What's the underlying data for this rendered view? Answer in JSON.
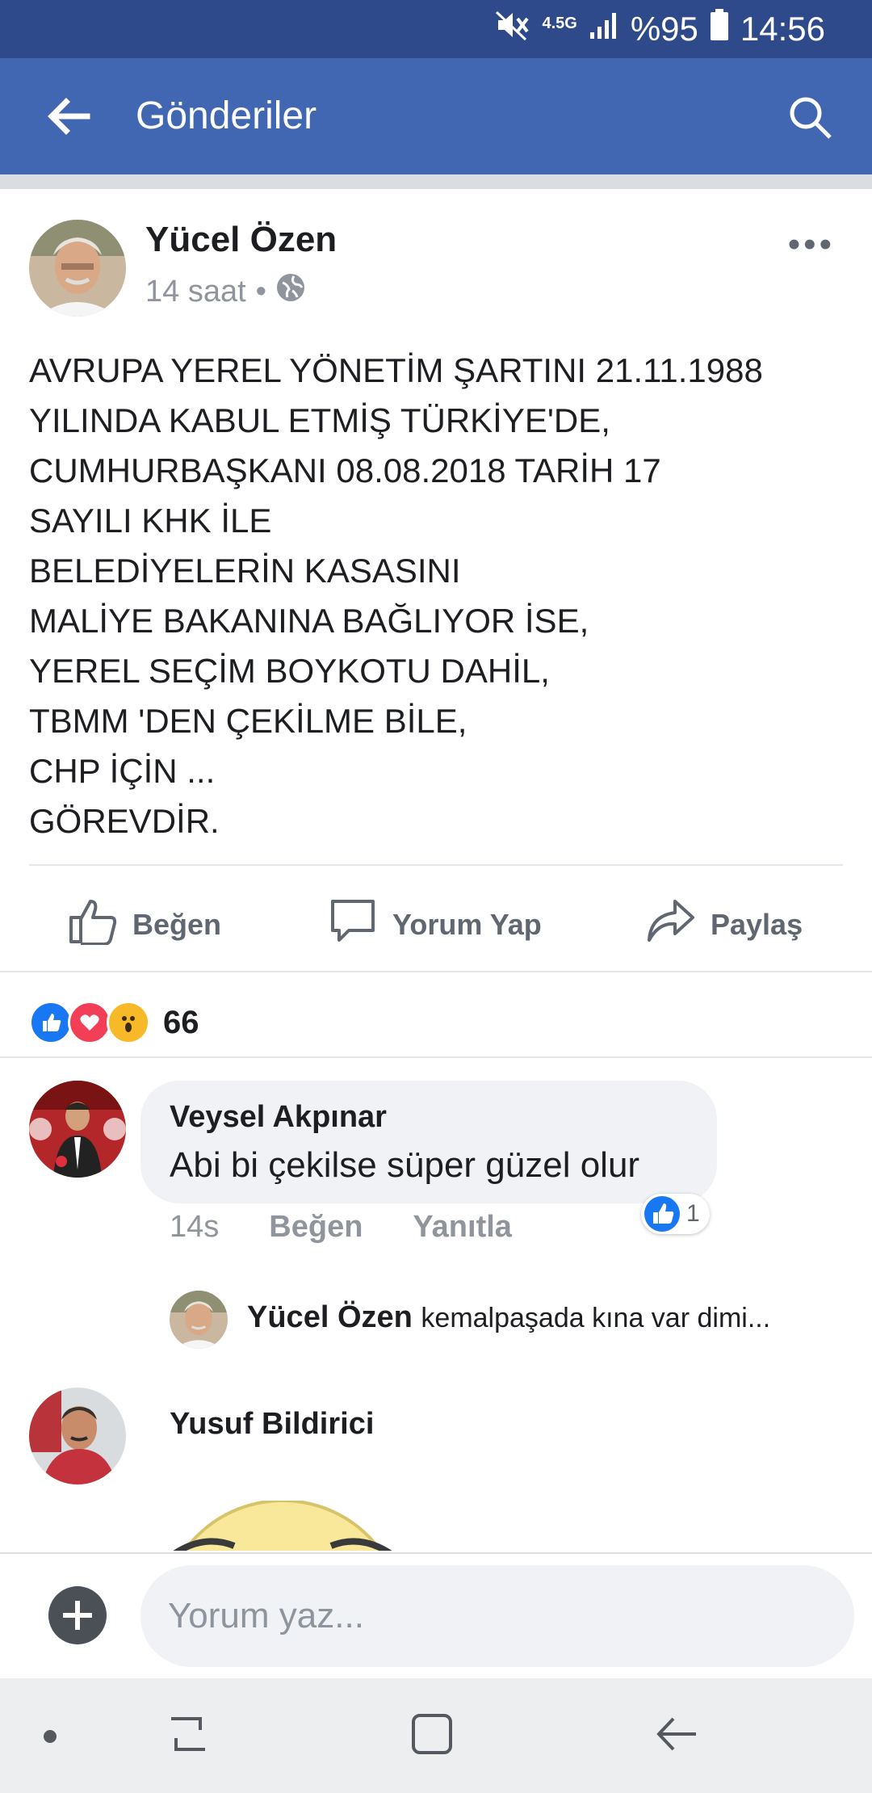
{
  "status_bar": {
    "network": "4.5G",
    "battery": "%95",
    "time": "14:56"
  },
  "app_bar": {
    "title": "Gönderiler",
    "back_icon": "arrow-left-icon",
    "search_icon": "search-icon"
  },
  "post": {
    "author": "Yücel Özen",
    "time": "14 saat",
    "separator": "•",
    "privacy_icon": "globe-icon",
    "lines": [
      "AVRUPA YEREL YÖNETİM ŞARTINI 21.11.1988",
      "YILINDA KABUL ETMİŞ TÜRKİYE'DE,",
      "CUMHURBAŞKANI 08.08.2018 TARİH 17",
      "SAYILI KHK İLE",
      "BELEDİYELERİN KASASINI",
      "MALİYE BAKANINA BAĞLIYOR İSE,",
      "YEREL SEÇİM BOYKOTU DAHİL,",
      "TBMM 'DEN ÇEKİLME BİLE,",
      "CHP İÇİN ...",
      "GÖREVDİR."
    ]
  },
  "actions": {
    "like": "Beğen",
    "comment": "Yorum Yap",
    "share": "Paylaş"
  },
  "reactions": {
    "count": "66",
    "types": [
      "like",
      "love",
      "wow"
    ]
  },
  "comments": [
    {
      "author": "Veysel Akpınar",
      "text": "Abi bi çekilse süper güzel olur",
      "time": "14s",
      "like_label": "Beğen",
      "reply_label": "Yanıtla",
      "like_count": "1",
      "reply": {
        "author": "Yücel Özen",
        "text": "kemalpaşada kına var dimi..."
      }
    },
    {
      "author": "Yusuf Bildirici"
    }
  ],
  "composer": {
    "placeholder": "Yorum yaz..."
  },
  "colors": {
    "status_bar": "#2f4a8a",
    "app_bar": "#4267b2",
    "like_blue": "#1877f2",
    "love_red": "#f33e58",
    "wow_yellow": "#f7b928"
  }
}
